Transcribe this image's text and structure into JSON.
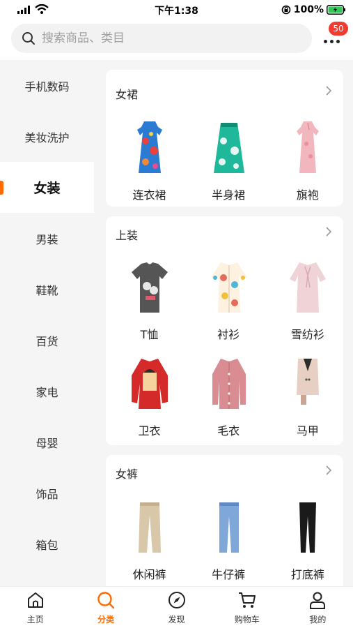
{
  "status_bar": {
    "time": "下午1:38",
    "battery": "100%"
  },
  "search": {
    "placeholder": "搜索商品、类目"
  },
  "header": {
    "badge": "50"
  },
  "sidebar": {
    "items": [
      {
        "label": "手机数码"
      },
      {
        "label": "美妆洗护"
      },
      {
        "label": "女装",
        "active": true
      },
      {
        "label": "男装"
      },
      {
        "label": "鞋靴"
      },
      {
        "label": "百货"
      },
      {
        "label": "家电"
      },
      {
        "label": "母婴"
      },
      {
        "label": "饰品"
      },
      {
        "label": "箱包"
      }
    ]
  },
  "sections": [
    {
      "title": "女裙",
      "items": [
        {
          "label": "连衣裙"
        },
        {
          "label": "半身裙"
        },
        {
          "label": "旗袍"
        }
      ]
    },
    {
      "title": "上装",
      "items": [
        {
          "label": "T恤"
        },
        {
          "label": "衬衫"
        },
        {
          "label": "雪纺衫"
        },
        {
          "label": "卫衣"
        },
        {
          "label": "毛衣"
        },
        {
          "label": "马甲"
        }
      ]
    },
    {
      "title": "女裤",
      "items": [
        {
          "label": "休闲裤"
        },
        {
          "label": "牛仔裤"
        },
        {
          "label": "打底裤"
        }
      ]
    }
  ],
  "tab_bar": {
    "tabs": [
      {
        "label": "主页",
        "icon": "home-icon"
      },
      {
        "label": "分类",
        "icon": "search-icon",
        "active": true
      },
      {
        "label": "发现",
        "icon": "compass-icon"
      },
      {
        "label": "购物车",
        "icon": "cart-icon"
      },
      {
        "label": "我的",
        "icon": "user-icon"
      }
    ]
  },
  "colors": {
    "accent": "#ff6b00",
    "badge": "#f03b2e",
    "battery": "#34c759"
  }
}
